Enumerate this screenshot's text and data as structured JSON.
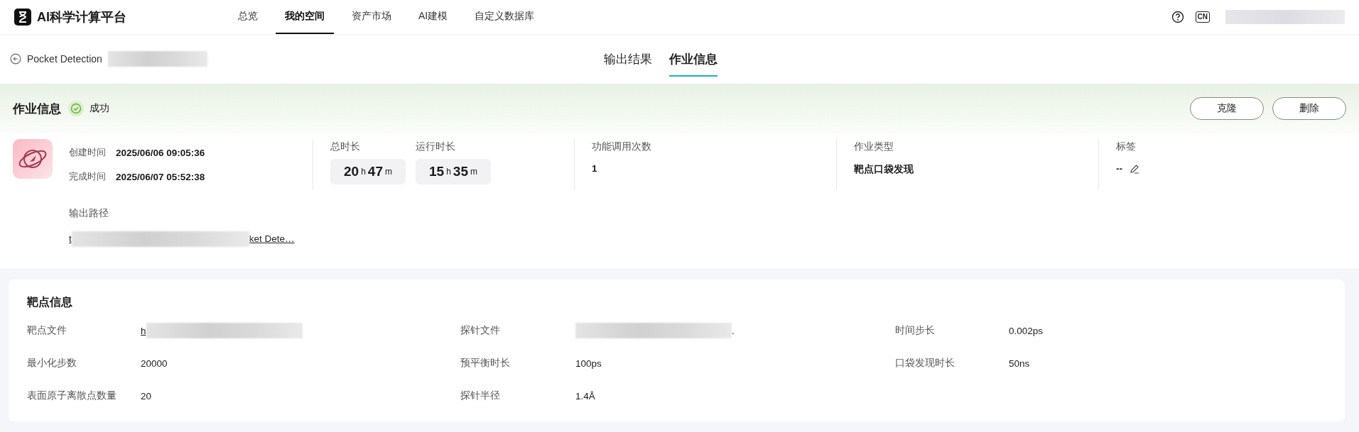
{
  "app": {
    "name": "AI科学计算平台"
  },
  "nav": [
    {
      "label": "总览",
      "selected": false
    },
    {
      "label": "我的空间",
      "selected": true
    },
    {
      "label": "资产市场",
      "selected": false
    },
    {
      "label": "AI建模",
      "selected": false
    },
    {
      "label": "自定义数据库",
      "selected": false
    }
  ],
  "top_icons": {
    "language": "CN"
  },
  "breadcrumb": {
    "title": "Pocket Detection"
  },
  "view_tabs": [
    {
      "label": "输出结果",
      "selected": false
    },
    {
      "label": "作业信息",
      "selected": true
    }
  ],
  "job": {
    "heading": "作业信息",
    "status": {
      "text": "成功",
      "kind": "success"
    },
    "buttons": [
      "克隆",
      "删除"
    ],
    "times": [
      {
        "label": "创建时间",
        "value": "2025/06/06 09:05:36"
      },
      {
        "label": "完成时间",
        "value": "2025/06/07 05:52:38"
      }
    ],
    "durations": [
      {
        "label": "总时长",
        "hours": "20",
        "h_unit": "h",
        "minutes": "47",
        "m_unit": "m"
      },
      {
        "label": "运行时长",
        "hours": "15",
        "h_unit": "h",
        "minutes": "35",
        "m_unit": "m"
      }
    ],
    "calls": {
      "label": "功能调用次数",
      "value": "1"
    },
    "type": {
      "label": "作业类型",
      "value": "靶点口袋发现"
    },
    "tags": {
      "label": "标签",
      "value": "--"
    },
    "output_path": {
      "label": "输出路径",
      "prefix": "t",
      "suffix": "ket Dete…"
    }
  },
  "target": {
    "heading": "靶点信息",
    "fields": [
      {
        "label": "靶点文件",
        "kind": "link",
        "prefix": "h"
      },
      {
        "label": "探针文件",
        "kind": "redacted",
        "suffix": "."
      },
      {
        "label": "时间步长",
        "kind": "text",
        "value": "0.002ps"
      },
      {
        "label": "最小化步数",
        "kind": "text",
        "value": "20000"
      },
      {
        "label": "预平衡时长",
        "kind": "text",
        "value": "100ps"
      },
      {
        "label": "口袋发现时长",
        "kind": "text",
        "value": "50ns"
      },
      {
        "label": "表面原子离散点数量",
        "kind": "text",
        "value": "20"
      },
      {
        "label": "探针半径",
        "kind": "text",
        "value": "1.4Å"
      }
    ]
  }
}
